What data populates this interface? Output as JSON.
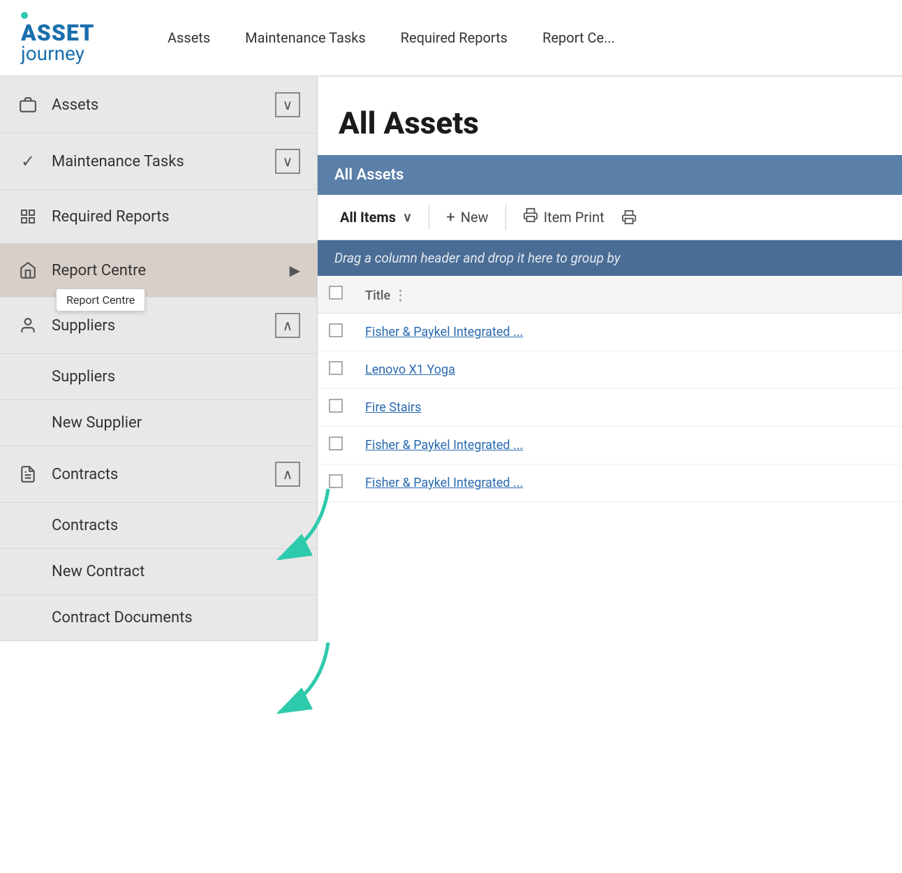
{
  "app": {
    "logo_top": "ASSET",
    "logo_bottom": "journey"
  },
  "top_nav": {
    "items": [
      {
        "label": "Assets",
        "id": "nav-assets"
      },
      {
        "label": "Maintenance Tasks",
        "id": "nav-maintenance"
      },
      {
        "label": "Required Reports",
        "id": "nav-required-reports"
      },
      {
        "label": "Report Ce...",
        "id": "nav-report-centre"
      }
    ]
  },
  "sidebar": {
    "items": [
      {
        "id": "assets",
        "label": "Assets",
        "icon": "briefcase",
        "chevron": "down",
        "active": false
      },
      {
        "id": "maintenance",
        "label": "Maintenance Tasks",
        "icon": "check",
        "chevron": "down",
        "active": false
      },
      {
        "id": "required-reports",
        "label": "Required Reports",
        "icon": "grid",
        "chevron": null,
        "active": false
      },
      {
        "id": "report-centre",
        "label": "Report Centre",
        "icon": "home",
        "chevron": null,
        "active": true,
        "tooltip": "Report Centre"
      },
      {
        "id": "suppliers",
        "label": "Suppliers",
        "icon": "person",
        "chevron": "up",
        "active": false
      }
    ],
    "suppliers_sub": [
      {
        "id": "suppliers-list",
        "label": "Suppliers"
      },
      {
        "id": "new-supplier",
        "label": "New Supplier"
      }
    ],
    "contracts": {
      "label": "Contracts",
      "icon": "document",
      "chevron": "up",
      "sub_items": [
        {
          "id": "contracts-list",
          "label": "Contracts"
        },
        {
          "id": "new-contract",
          "label": "New Contract"
        },
        {
          "id": "contract-documents",
          "label": "Contract Documents"
        }
      ]
    }
  },
  "main": {
    "title": "All Assets",
    "table_header": "All Assets",
    "filter_label": "All Items",
    "new_label": "+ New",
    "item_print_label": "Item Print",
    "group_by_text": "Drag a column header and drop it here to group by",
    "columns": [
      {
        "label": "Title"
      }
    ],
    "rows": [
      {
        "id": 1,
        "title": "Fisher & Paykel Integrated ..."
      },
      {
        "id": 2,
        "title": "Lenovo X1 Yoga"
      },
      {
        "id": 3,
        "title": "Fire Stairs"
      },
      {
        "id": 4,
        "title": "Fisher & Paykel Integrated ..."
      },
      {
        "id": 5,
        "title": "Fisher & Paykel Integrated ..."
      }
    ]
  },
  "icons": {
    "briefcase": "🗂",
    "check": "✓",
    "grid": "▦",
    "home": "⌂",
    "person": "👤",
    "document": "📄",
    "chevron_down": "∨",
    "chevron_up": "∧",
    "printer": "🖨",
    "plus": "+"
  }
}
